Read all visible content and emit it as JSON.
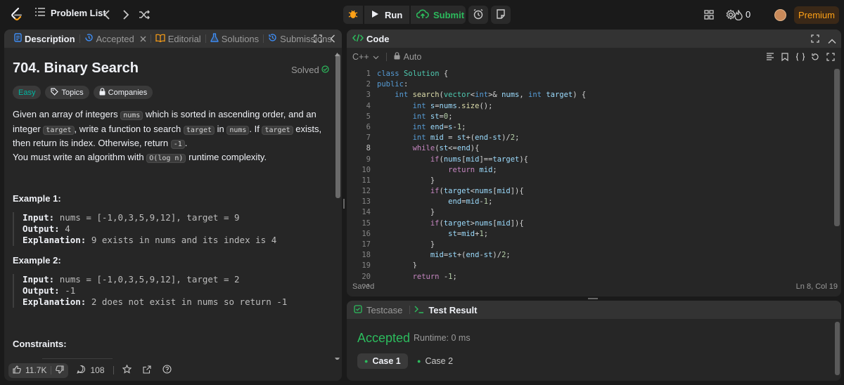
{
  "topbar": {
    "problem_list": "Problem List",
    "run": "Run",
    "submit": "Submit",
    "streak": "0",
    "premium": "Premium"
  },
  "left": {
    "tabs": [
      {
        "label": "Description"
      },
      {
        "label": "Accepted"
      },
      {
        "label": "Editorial"
      },
      {
        "label": "Solutions"
      },
      {
        "label": "Submissions"
      }
    ],
    "title": "704. Binary Search",
    "solved": "Solved",
    "tags": [
      "Easy",
      "Topics",
      "Companies"
    ],
    "para1_a": "Given an array of integers ",
    "para1_nums": "nums",
    "para1_b": " which is sorted in ascending order, and an integer ",
    "para1_target": "target",
    "para1_c": ", write a function to search ",
    "para1_target2": "target",
    "para1_d": " in ",
    "para1_nums2": "nums",
    "para1_e": ". If ",
    "para1_target3": "target",
    "para1_f": " exists, then return its index. Otherwise, return ",
    "para1_neg": "-1",
    "para1_g": ".",
    "para2_a": "You must write an algorithm with ",
    "para2_code": "O(log n)",
    "para2_b": " runtime complexity.",
    "example1_title": "Example 1:",
    "example1": {
      "input_label": "Input:",
      "input": "nums = [-1,0,3,5,9,12], target = 9",
      "output_label": "Output:",
      "output": "4",
      "expl_label": "Explanation:",
      "expl": "9 exists in nums and its index is 4"
    },
    "example2_title": "Example 2:",
    "example2": {
      "input_label": "Input:",
      "input": "nums = [-1,0,3,5,9,12], target = 2",
      "output_label": "Output:",
      "output": "-1",
      "expl_label": "Explanation:",
      "expl": "2 does not exist in nums so return -1"
    },
    "constraints_title": "Constraints:",
    "likes": "11.7K",
    "comments": "108"
  },
  "code": {
    "title": "Code",
    "language": "C++",
    "mode": "Auto",
    "status_left": "Saved",
    "status_right": "Ln 8, Col 19"
  },
  "test": {
    "tab_testcase": "Testcase",
    "tab_result": "Test Result",
    "verdict": "Accepted",
    "runtime": "Runtime: 0 ms",
    "case1": "Case 1",
    "case2": "Case 2"
  }
}
